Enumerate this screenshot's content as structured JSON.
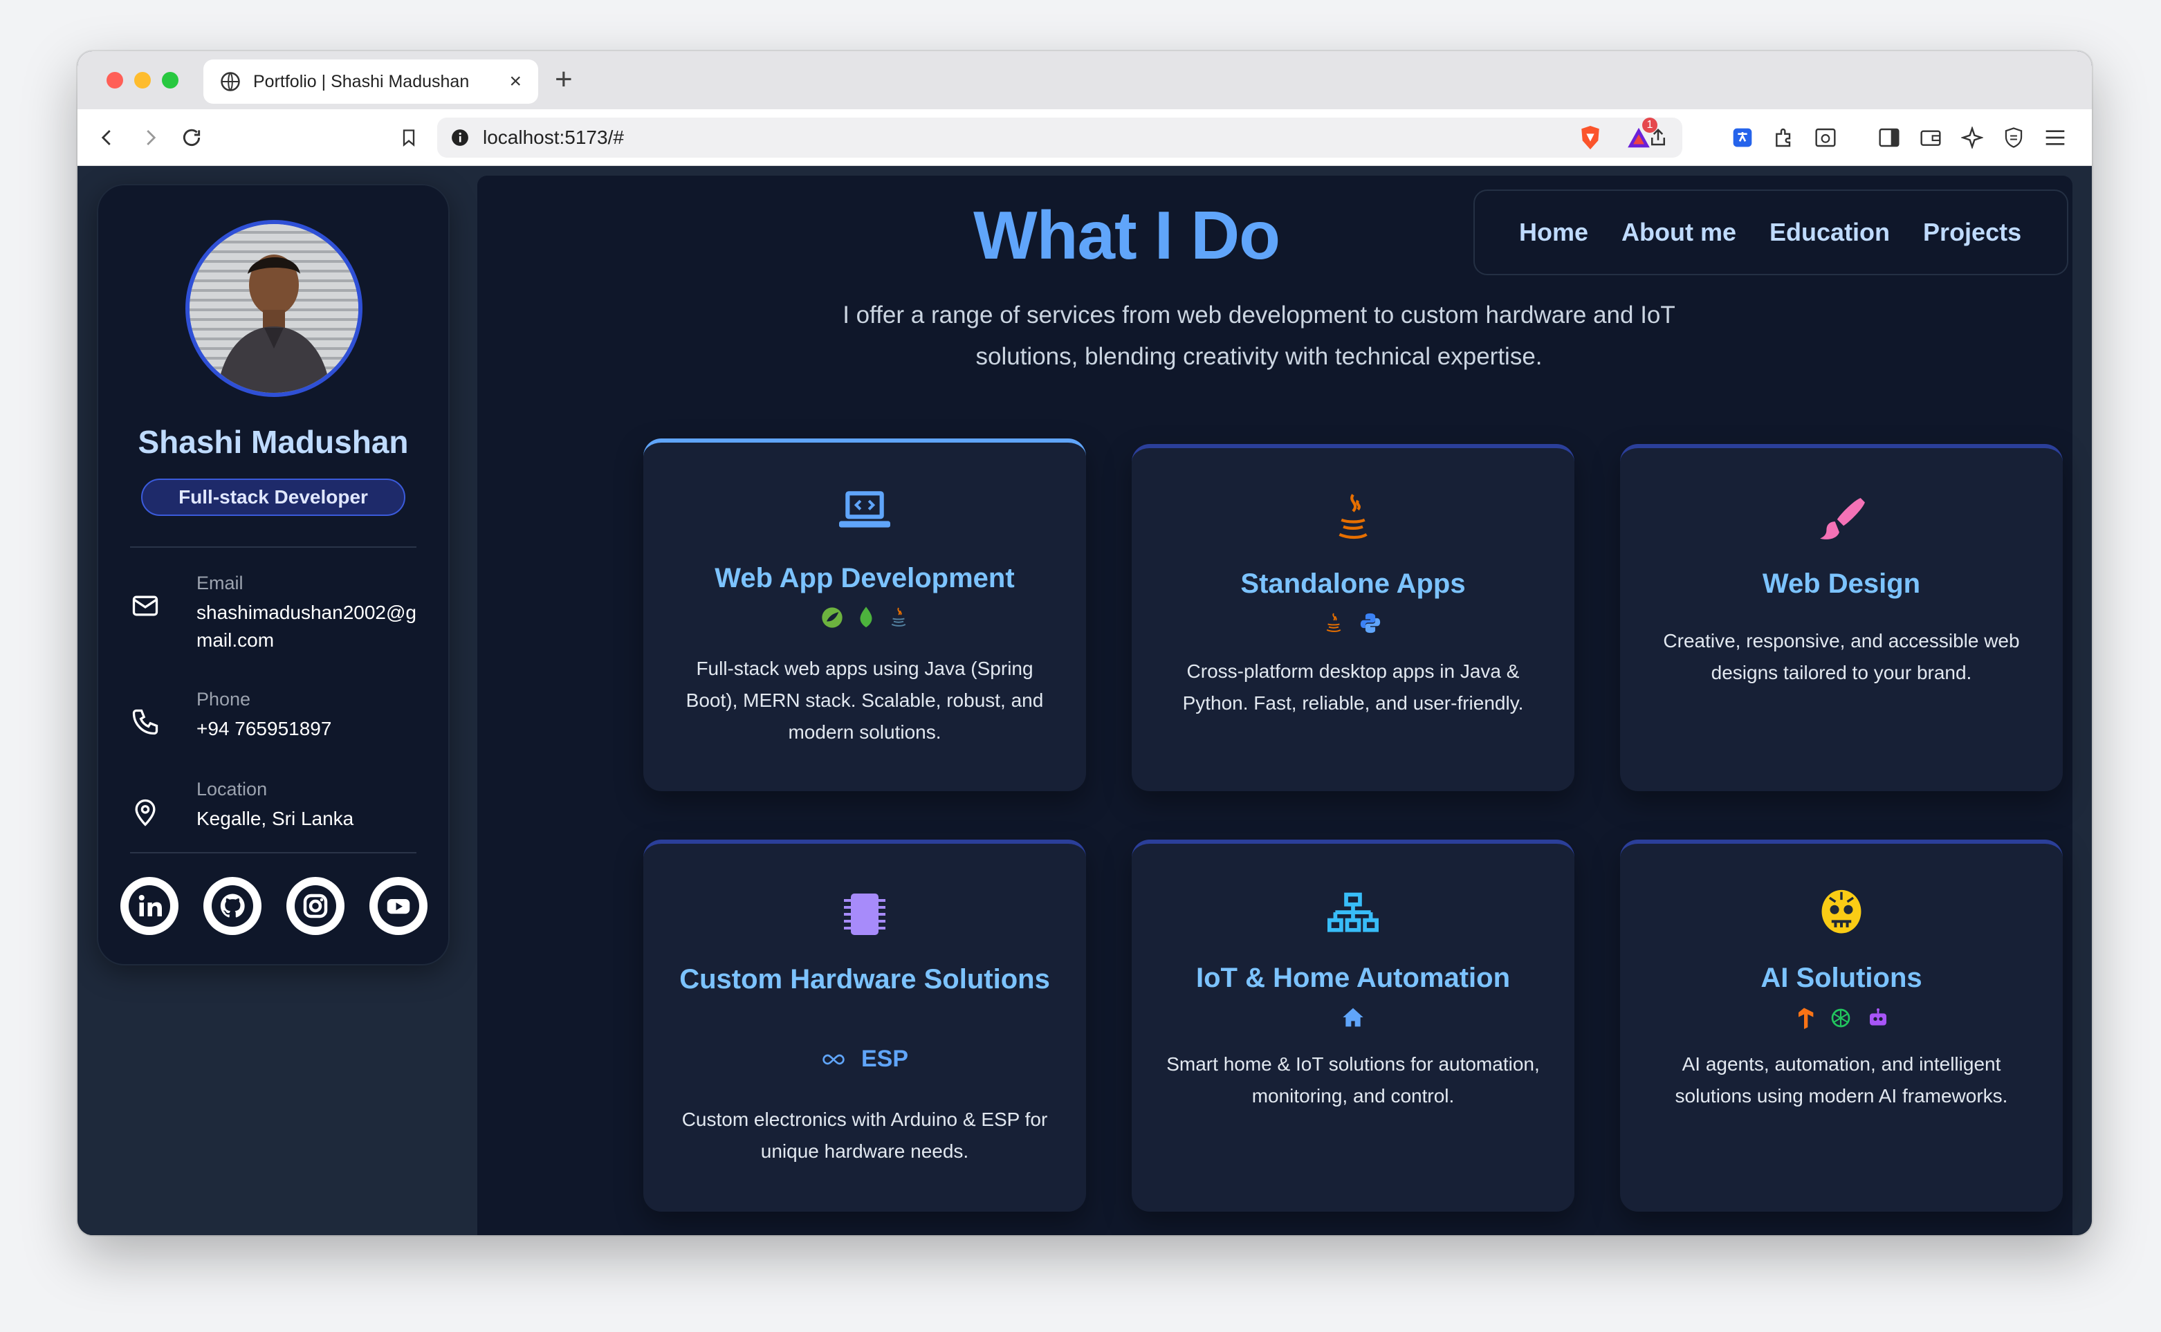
{
  "browser": {
    "tab_title": "Portfolio | Shashi Madushan",
    "tab_close": "×",
    "new_tab": "+",
    "url": "localhost:5173/#",
    "notification_badge": "1"
  },
  "sidebar": {
    "name": "Shashi Madushan",
    "role": "Full-stack Developer",
    "contacts": [
      {
        "label": "Email",
        "value": "shashimadushan2002@gmail.com",
        "icon": "mail-icon"
      },
      {
        "label": "Phone",
        "value": "+94 765951897",
        "icon": "phone-icon"
      },
      {
        "label": "Location",
        "value": "Kegalle, Sri Lanka",
        "icon": "location-pin-icon"
      }
    ],
    "socials": [
      "linkedin-icon",
      "github-icon",
      "instagram-icon",
      "youtube-icon"
    ]
  },
  "main": {
    "heading": "What I Do",
    "intro": "I offer a range of services from web development to custom hardware and IoT solutions, blending creativity with technical expertise.",
    "nav": [
      "Home",
      "About me",
      "Education",
      "Projects"
    ],
    "cards": [
      {
        "title": "Web App Development",
        "desc": "Full-stack web apps using Java (Spring Boot), MERN stack. Scalable, robust, and modern solutions.",
        "icon": "laptop-code-icon"
      },
      {
        "title": "Standalone Apps",
        "desc": "Cross-platform desktop apps in Java & Python. Fast, reliable, and user-friendly.",
        "icon": "java-icon"
      },
      {
        "title": "Web Design",
        "desc": "Creative, responsive, and accessible web designs tailored to your brand.",
        "icon": "paint-brush-icon"
      },
      {
        "title": "Custom Hardware Solutions",
        "desc": "Custom electronics with Arduino & ESP for unique hardware needs.",
        "icon": "chip-icon",
        "tag_text": "ESP"
      },
      {
        "title": "IoT & Home Automation",
        "desc": "Smart home & IoT solutions for automation, monitoring, and control.",
        "icon": "network-icon"
      },
      {
        "title": "AI Solutions",
        "desc": "AI agents, automation, and intelligent solutions using modern AI frameworks.",
        "icon": "ai-brain-icon"
      }
    ]
  },
  "colors": {
    "accent": "#60a5fa",
    "card_bg": "#172036",
    "page_bg": "#0f172a"
  }
}
